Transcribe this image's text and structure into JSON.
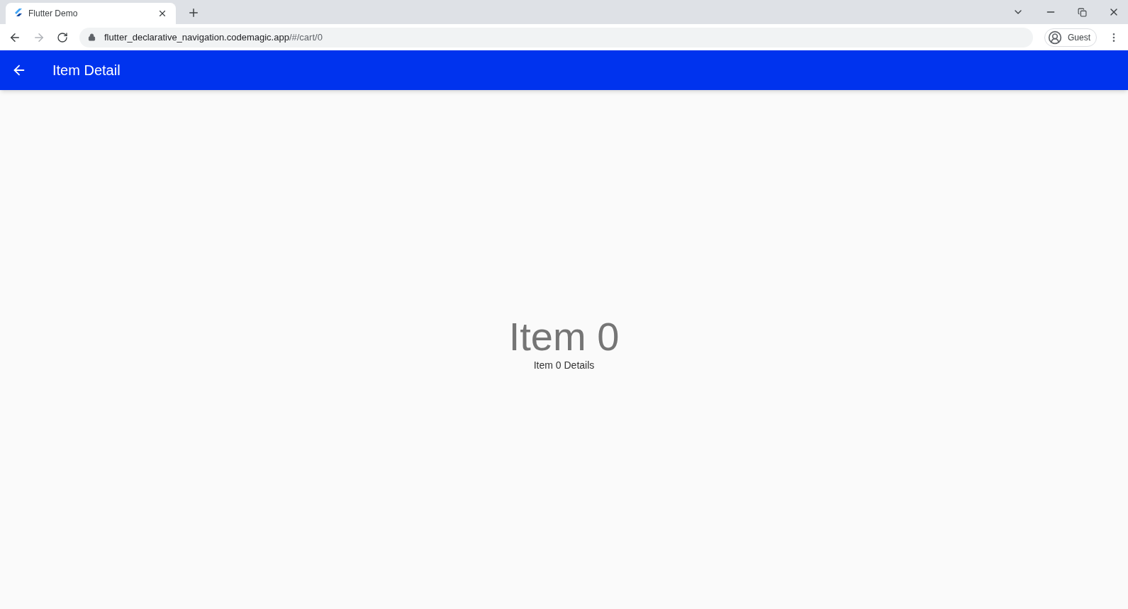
{
  "browser": {
    "tab": {
      "title": "Flutter Demo",
      "selected": true
    },
    "url": {
      "host": "flutter_declarative_navigation.codemagic.app",
      "path": "/#/cart/0"
    },
    "forward_disabled": true,
    "profile": "Guest"
  },
  "app_bar": {
    "title": "Item Detail"
  },
  "content": {
    "heading": "Item 0",
    "subtitle": "Item 0 Details"
  }
}
